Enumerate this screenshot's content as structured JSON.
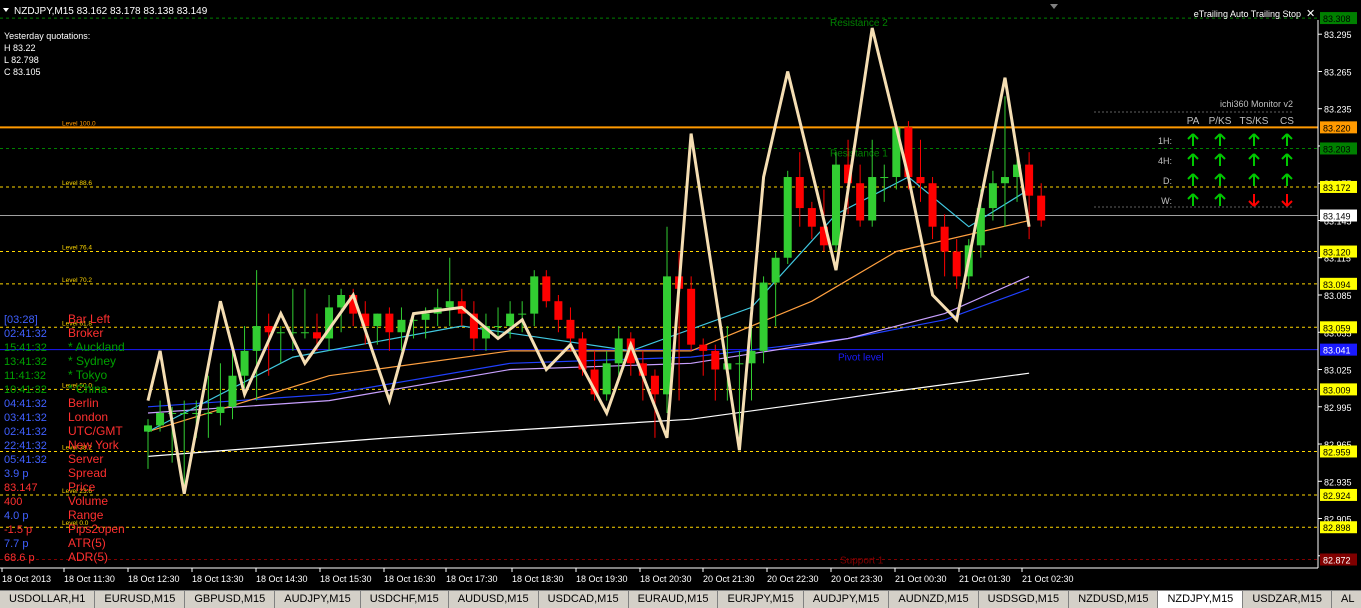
{
  "header": {
    "symbol_line": "NZDJPY,M15  83.162 83.178 83.138 83.149",
    "expert_title": "eTrailing Auto Trailing Stop",
    "smile_icon": "smile-icon",
    "triangle_icon": "dropdown-triangle-icon"
  },
  "yesterday": {
    "title": "Yesterday quotations:",
    "h": "H 83.22",
    "l": "L 82.798",
    "c": "C 83.105"
  },
  "monitor": {
    "title": "ichi360 Monitor v2",
    "columns": [
      "PA",
      "P/KS",
      "TS/KS",
      "CS"
    ],
    "rows": [
      {
        "label": "1H:",
        "signals": [
          "up",
          "up",
          "up",
          "up"
        ]
      },
      {
        "label": "4H:",
        "signals": [
          "up",
          "up",
          "up",
          "up"
        ]
      },
      {
        "label": "D:",
        "signals": [
          "up",
          "up",
          "up",
          "up"
        ]
      },
      {
        "label": "W:",
        "signals": [
          "up",
          "up",
          "down",
          "down"
        ]
      }
    ],
    "up_color": "#00c800",
    "down_color": "#ff0000"
  },
  "info_panel": [
    {
      "value": "[03:28]",
      "label": "Bar Left",
      "value_color": "#4060ff",
      "label_color": "#ff3030"
    },
    {
      "value": "02:41:32",
      "label": "Broker",
      "value_color": "#4060ff",
      "label_color": "#ff3030"
    },
    {
      "value": "15:41:32",
      "label": "* Auckland",
      "value_color": "#00a000",
      "label_color": "#00a000"
    },
    {
      "value": "13:41:32",
      "label": "* Sydney",
      "value_color": "#00a000",
      "label_color": "#00a000"
    },
    {
      "value": "11:41:32",
      "label": "* Tokyo",
      "value_color": "#00a000",
      "label_color": "#00a000"
    },
    {
      "value": "10:41:32",
      "label": "* China",
      "value_color": "#00a000",
      "label_color": "#00a000"
    },
    {
      "value": "04:41:32",
      "label": "Berlin",
      "value_color": "#4060ff",
      "label_color": "#ff3030"
    },
    {
      "value": "03:41:32",
      "label": "London",
      "value_color": "#4060ff",
      "label_color": "#ff3030"
    },
    {
      "value": "02:41:32",
      "label": "UTC/GMT",
      "value_color": "#4060ff",
      "label_color": "#ff3030"
    },
    {
      "value": "22:41:32",
      "label": "New York",
      "value_color": "#4060ff",
      "label_color": "#ff3030"
    },
    {
      "value": "05:41:32",
      "label": "Server",
      "value_color": "#4060ff",
      "label_color": "#ff3030"
    },
    {
      "value": "3.9 p",
      "label": "Spread",
      "value_color": "#4060ff",
      "label_color": "#ff3030"
    },
    {
      "value": "83.147",
      "label": "Price",
      "value_color": "#ff3030",
      "label_color": "#ff3030"
    },
    {
      "value": "400",
      "label": "Volume",
      "value_color": "#ff3030",
      "label_color": "#ff3030"
    },
    {
      "value": "4.0 p",
      "label": "Range",
      "value_color": "#4060ff",
      "label_color": "#ff3030"
    },
    {
      "value": "-1.5 p",
      "label": "Pips2open",
      "value_color": "#ff3030",
      "label_color": "#ff3030"
    },
    {
      "value": "7.7 p",
      "label": "ATR(5)",
      "value_color": "#4060ff",
      "label_color": "#ff3030"
    },
    {
      "value": "68.6 p",
      "label": "ADR(5)",
      "value_color": "#ff3030",
      "label_color": "#ff3030"
    }
  ],
  "tabs": [
    "USDOLLAR,H1",
    "EURUSD,M15",
    "GBPUSD,M15",
    "AUDJPY,M15",
    "USDCHF,M15",
    "AUDUSD,M15",
    "USDCAD,M15",
    "EURAUD,M15",
    "EURJPY,M15",
    "AUDJPY,M15",
    "AUDNZD,M15",
    "USDSGD,M15",
    "NZDUSD,M15",
    "NZDJPY,M15",
    "USDZAR,M15",
    "AL"
  ],
  "active_tab": 13,
  "chart_data": {
    "type": "candlestick",
    "symbol": "NZDJPY",
    "timeframe": "M15",
    "ylim": [
      82.85,
      83.32
    ],
    "price_ticks": [
      "83.295",
      "83.265",
      "83.235",
      "83.205",
      "83.175",
      "83.145",
      "83.115",
      "83.085",
      "83.055",
      "83.025",
      "82.995",
      "82.965",
      "82.935",
      "82.905",
      "82.875"
    ],
    "time_labels": [
      "18 Oct 2013",
      "18 Oct 11:30",
      "18 Oct 12:30",
      "18 Oct 13:30",
      "18 Oct 14:30",
      "18 Oct 15:30",
      "18 Oct 16:30",
      "18 Oct 17:30",
      "18 Oct 18:30",
      "18 Oct 19:30",
      "18 Oct 20:30",
      "20 Oct 21:30",
      "20 Oct 22:30",
      "20 Oct 23:30",
      "21 Oct 00:30",
      "21 Oct 01:30",
      "21 Oct 02:30"
    ],
    "levels": [
      {
        "price": 83.22,
        "label": "Level 100.0",
        "tag": "83.220",
        "color": "#ff9900",
        "style": "solid",
        "tag_bg": "#ff9900",
        "tag_color": "#000000"
      },
      {
        "price": 83.172,
        "label": "Level 88.6",
        "tag": "83.172",
        "color": "#ffd700",
        "style": "dash",
        "tag_bg": "#ffff00",
        "tag_color": "#000000"
      },
      {
        "price": 83.12,
        "label": "Level 76.4",
        "tag": "83.120",
        "color": "#ffd700",
        "style": "dash",
        "tag_bg": "#ffff00",
        "tag_color": "#000000"
      },
      {
        "price": 83.094,
        "label": "Level 70.2",
        "tag": "83.094",
        "color": "#ffd700",
        "style": "dash",
        "tag_bg": "#ffff00",
        "tag_color": "#000000"
      },
      {
        "price": 83.059,
        "label": "Level 61.8",
        "tag": "83.059",
        "color": "#ffd700",
        "style": "dash",
        "tag_bg": "#ffff00",
        "tag_color": "#000000"
      },
      {
        "price": 83.009,
        "label": "Level 50.0",
        "tag": "83.009",
        "color": "#ffd700",
        "style": "dash",
        "tag_bg": "#ffff00",
        "tag_color": "#000000"
      },
      {
        "price": 82.959,
        "label": "Level 38.2",
        "tag": "82.959",
        "color": "#ffd700",
        "style": "dash",
        "tag_bg": "#ffff00",
        "tag_color": "#000000"
      },
      {
        "price": 82.924,
        "label": "Level 23.6",
        "tag": "82.924",
        "color": "#ffd700",
        "style": "dash",
        "tag_bg": "#ffff00",
        "tag_color": "#000000"
      },
      {
        "price": 82.898,
        "label": "Level 0.0",
        "tag": "82.898",
        "color": "#ffd700",
        "style": "dash",
        "tag_bg": "#ffff00",
        "tag_color": "#000000"
      }
    ],
    "pivot": {
      "price": 83.041,
      "label": "Pivot level",
      "tag": "83.041",
      "color": "#1a1aff"
    },
    "resistance2": {
      "price": 83.308,
      "label": "Resistance 2",
      "tag": "83.308",
      "color": "#008000"
    },
    "resistance1": {
      "price": 83.203,
      "label": "Resistance 1",
      "tag": "83.203",
      "color": "#008000"
    },
    "support1": {
      "price": 82.872,
      "label": "Support 1",
      "tag": "82.872",
      "color": "#800000"
    },
    "current_price": {
      "price": 83.149,
      "tag": "83.149"
    },
    "candles": [
      [
        82.975,
        82.985,
        82.945,
        82.98
      ],
      [
        82.98,
        83.0,
        82.975,
        82.99
      ],
      [
        82.99,
        82.995,
        82.95,
        82.99
      ],
      [
        82.99,
        83.0,
        82.925,
        82.99
      ],
      [
        82.99,
        83.0,
        82.97,
        82.99
      ],
      [
        82.99,
        83.02,
        82.97,
        82.99
      ],
      [
        82.99,
        83.03,
        82.98,
        82.995
      ],
      [
        82.995,
        83.04,
        82.985,
        83.02
      ],
      [
        83.02,
        83.06,
        83.01,
        83.04
      ],
      [
        83.04,
        83.105,
        83.0,
        83.06
      ],
      [
        83.06,
        83.07,
        83.02,
        83.055
      ],
      [
        83.055,
        83.06,
        83.03,
        83.055
      ],
      [
        83.055,
        83.09,
        83.04,
        83.055
      ],
      [
        83.055,
        83.09,
        83.05,
        83.055
      ],
      [
        83.055,
        83.07,
        83.04,
        83.05
      ],
      [
        83.05,
        83.085,
        83.04,
        83.075
      ],
      [
        83.075,
        83.09,
        83.055,
        83.085
      ],
      [
        83.085,
        83.09,
        83.06,
        83.07
      ],
      [
        83.07,
        83.08,
        83.045,
        83.06
      ],
      [
        83.06,
        83.07,
        83.045,
        83.07
      ],
      [
        83.07,
        83.075,
        83.04,
        83.055
      ],
      [
        83.055,
        83.075,
        83.04,
        83.065
      ],
      [
        83.065,
        83.07,
        83.05,
        83.065
      ],
      [
        83.065,
        83.075,
        83.05,
        83.07
      ],
      [
        83.07,
        83.09,
        83.06,
        83.075
      ],
      [
        83.075,
        83.115,
        83.06,
        83.08
      ],
      [
        83.08,
        83.09,
        83.06,
        83.07
      ],
      [
        83.07,
        83.08,
        83.04,
        83.05
      ],
      [
        83.05,
        83.07,
        83.04,
        83.06
      ],
      [
        83.06,
        83.075,
        83.05,
        83.06
      ],
      [
        83.06,
        83.08,
        83.05,
        83.07
      ],
      [
        83.07,
        83.08,
        83.055,
        83.07
      ],
      [
        83.07,
        83.105,
        83.06,
        83.1
      ],
      [
        83.1,
        83.105,
        83.075,
        83.08
      ],
      [
        83.08,
        83.085,
        83.055,
        83.065
      ],
      [
        83.065,
        83.075,
        83.04,
        83.05
      ],
      [
        83.05,
        83.055,
        83.02,
        83.025
      ],
      [
        83.025,
        83.04,
        83.0,
        83.005
      ],
      [
        83.005,
        83.04,
        83.0,
        83.03
      ],
      [
        83.03,
        83.06,
        83.02,
        83.05
      ],
      [
        83.05,
        83.055,
        83.02,
        83.03
      ],
      [
        83.03,
        83.04,
        83.0,
        83.02
      ],
      [
        83.02,
        83.025,
        82.97,
        83.005
      ],
      [
        83.005,
        83.14,
        82.99,
        83.1
      ],
      [
        83.1,
        83.12,
        83.0,
        83.09
      ],
      [
        83.09,
        83.1,
        83.04,
        83.045
      ],
      [
        83.045,
        83.05,
        83.02,
        83.04
      ],
      [
        83.04,
        83.045,
        83.0,
        83.025
      ],
      [
        83.025,
        83.06,
        83.0,
        83.03
      ],
      [
        83.03,
        83.04,
        82.97,
        83.03
      ],
      [
        83.03,
        83.06,
        83.0,
        83.04
      ],
      [
        83.04,
        83.1,
        83.03,
        83.095
      ],
      [
        83.095,
        83.12,
        83.06,
        83.115
      ],
      [
        83.115,
        83.185,
        83.11,
        83.18
      ],
      [
        83.18,
        83.2,
        83.14,
        83.155
      ],
      [
        83.155,
        83.16,
        83.13,
        83.14
      ],
      [
        83.14,
        83.17,
        83.12,
        83.125
      ],
      [
        83.125,
        83.2,
        83.12,
        83.19
      ],
      [
        83.19,
        83.21,
        83.15,
        83.175
      ],
      [
        83.175,
        83.19,
        83.14,
        83.145
      ],
      [
        83.145,
        83.21,
        83.14,
        83.18
      ],
      [
        83.18,
        83.19,
        83.16,
        83.18
      ],
      [
        83.18,
        83.225,
        83.17,
        83.22
      ],
      [
        83.22,
        83.225,
        83.17,
        83.18
      ],
      [
        83.18,
        83.21,
        83.16,
        83.175
      ],
      [
        83.175,
        83.18,
        83.13,
        83.14
      ],
      [
        83.14,
        83.15,
        83.1,
        83.12
      ],
      [
        83.12,
        83.13,
        83.09,
        83.1
      ],
      [
        83.1,
        83.13,
        83.09,
        83.125
      ],
      [
        83.125,
        83.17,
        83.115,
        83.155
      ],
      [
        83.155,
        83.185,
        83.145,
        83.175
      ],
      [
        83.175,
        83.245,
        83.14,
        83.18
      ],
      [
        83.18,
        83.2,
        83.16,
        83.19
      ],
      [
        83.19,
        83.2,
        83.13,
        83.165
      ],
      [
        83.165,
        83.175,
        83.14,
        83.145
      ]
    ],
    "zigzag": [
      [
        0,
        83.0
      ],
      [
        1,
        83.04
      ],
      [
        3,
        82.925
      ],
      [
        6,
        83.08
      ],
      [
        8,
        83.005
      ],
      [
        11,
        83.07
      ],
      [
        13,
        83.03
      ],
      [
        17,
        83.085
      ],
      [
        20,
        83.0
      ],
      [
        22,
        83.07
      ],
      [
        26,
        83.075
      ],
      [
        29,
        83.05
      ],
      [
        31,
        83.065
      ],
      [
        33,
        83.025
      ],
      [
        35,
        83.045
      ],
      [
        38,
        82.99
      ],
      [
        40,
        83.045
      ],
      [
        43,
        82.97
      ],
      [
        45,
        83.215
      ],
      [
        49,
        82.96
      ],
      [
        51,
        83.18
      ],
      [
        53,
        83.265
      ],
      [
        57,
        83.105
      ],
      [
        60,
        83.3
      ],
      [
        63,
        83.18
      ],
      [
        65,
        83.085
      ],
      [
        67,
        83.065
      ],
      [
        71,
        83.26
      ],
      [
        73,
        83.14
      ]
    ],
    "ma_lines": [
      {
        "name": "white",
        "color": "#ffffff",
        "points": [
          [
            0,
            82.955
          ],
          [
            20,
            82.97
          ],
          [
            45,
            82.985
          ],
          [
            60,
            83.005
          ],
          [
            73,
            83.022
          ]
        ]
      },
      {
        "name": "blue",
        "color": "#2040ff",
        "points": [
          [
            0,
            82.995
          ],
          [
            15,
            83.005
          ],
          [
            30,
            83.03
          ],
          [
            45,
            83.035
          ],
          [
            58,
            83.05
          ],
          [
            66,
            83.065
          ],
          [
            73,
            83.09
          ]
        ]
      },
      {
        "name": "violet",
        "color": "#c8a0ff",
        "points": [
          [
            0,
            82.99
          ],
          [
            15,
            83.0
          ],
          [
            30,
            83.025
          ],
          [
            45,
            83.03
          ],
          [
            58,
            83.05
          ],
          [
            66,
            83.07
          ],
          [
            73,
            83.1
          ]
        ]
      },
      {
        "name": "orange",
        "color": "#ffa040",
        "points": [
          [
            0,
            82.975
          ],
          [
            15,
            83.02
          ],
          [
            30,
            83.04
          ],
          [
            45,
            83.04
          ],
          [
            55,
            83.08
          ],
          [
            62,
            83.12
          ],
          [
            73,
            83.145
          ]
        ]
      },
      {
        "name": "cyan",
        "color": "#40c8e0",
        "points": [
          [
            0,
            82.975
          ],
          [
            12,
            83.035
          ],
          [
            26,
            83.06
          ],
          [
            40,
            83.04
          ],
          [
            50,
            83.075
          ],
          [
            57,
            83.15
          ],
          [
            63,
            83.18
          ],
          [
            68,
            83.14
          ],
          [
            73,
            83.17
          ]
        ]
      }
    ]
  }
}
